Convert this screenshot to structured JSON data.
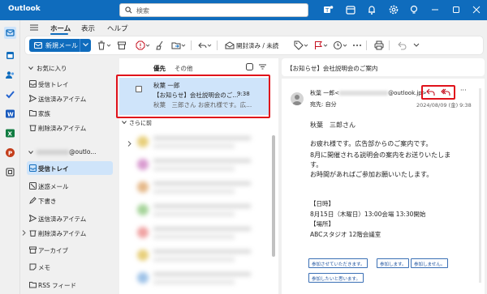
{
  "app": {
    "title": "Outlook"
  },
  "search": {
    "placeholder": "検索"
  },
  "tabs": [
    {
      "label": "ホーム",
      "active": true
    },
    {
      "label": "表示",
      "active": false
    },
    {
      "label": "ヘルプ",
      "active": false
    }
  ],
  "ribbon": {
    "new_mail_label": "新規メール",
    "read_unread_label": "開封済み / 未読"
  },
  "folders": {
    "favorites_header": "お気に入り",
    "favorites": [
      {
        "label": "受信トレイ",
        "icon": "inbox-icon"
      },
      {
        "label": "送信済みアイテム",
        "icon": "send-icon"
      },
      {
        "label": "家族",
        "icon": "folder-icon"
      },
      {
        "label": "削除済みアイテム",
        "icon": "trash-icon"
      }
    ],
    "account_suffix": "@outlo...",
    "account_folders": [
      {
        "label": "受信トレイ",
        "icon": "inbox-icon",
        "selected": true
      },
      {
        "label": "迷惑メール",
        "icon": "junk-icon"
      },
      {
        "label": "下書き",
        "icon": "draft-icon"
      },
      {
        "label": "送信済みアイテム",
        "icon": "send-icon"
      },
      {
        "label": "削除済みアイテム",
        "icon": "trash-icon"
      },
      {
        "label": "アーカイブ",
        "icon": "archive-icon"
      },
      {
        "label": "メモ",
        "icon": "note-icon"
      },
      {
        "label": "RSS フィード",
        "icon": "folder-icon"
      }
    ]
  },
  "message_list": {
    "tab_focused": "優先",
    "tab_other": "その他",
    "selected_message": {
      "from": "秋葉 一郎",
      "subject": "【お知らせ】会社説明会のご...",
      "time": "9:38",
      "preview": "秋葉　三郎さん お疲れ様です。広..."
    },
    "earlier_label": "さらに前"
  },
  "reading": {
    "subject": "【お知らせ】会社説明会のご案内",
    "sender_name": "秋葉 一郎<",
    "sender_domain": "@outlook.jp>",
    "to": "宛先:  自分",
    "date": "2024/08/09 (金) 9:38",
    "body": [
      "秋葉　三郎さん",
      "お疲れ様です。広告部からのご案内です。",
      "8月に開催される説明会の案内をお送りいたしま",
      "す。",
      "お時間があればご参加お願いいたします。",
      "【日時】",
      "8月15日（木曜日）13:00会場 13:30開始",
      "【場所】",
      "ABCスタジオ 12階会議室"
    ],
    "vote_buttons": [
      "参加させていただきます。",
      "参加します。",
      "参加しません。",
      "参加したいと思います。"
    ]
  },
  "colors": {
    "brand": "#0f6cbd",
    "selected": "#cfe4fa",
    "highlight_box": "#e0121b"
  }
}
